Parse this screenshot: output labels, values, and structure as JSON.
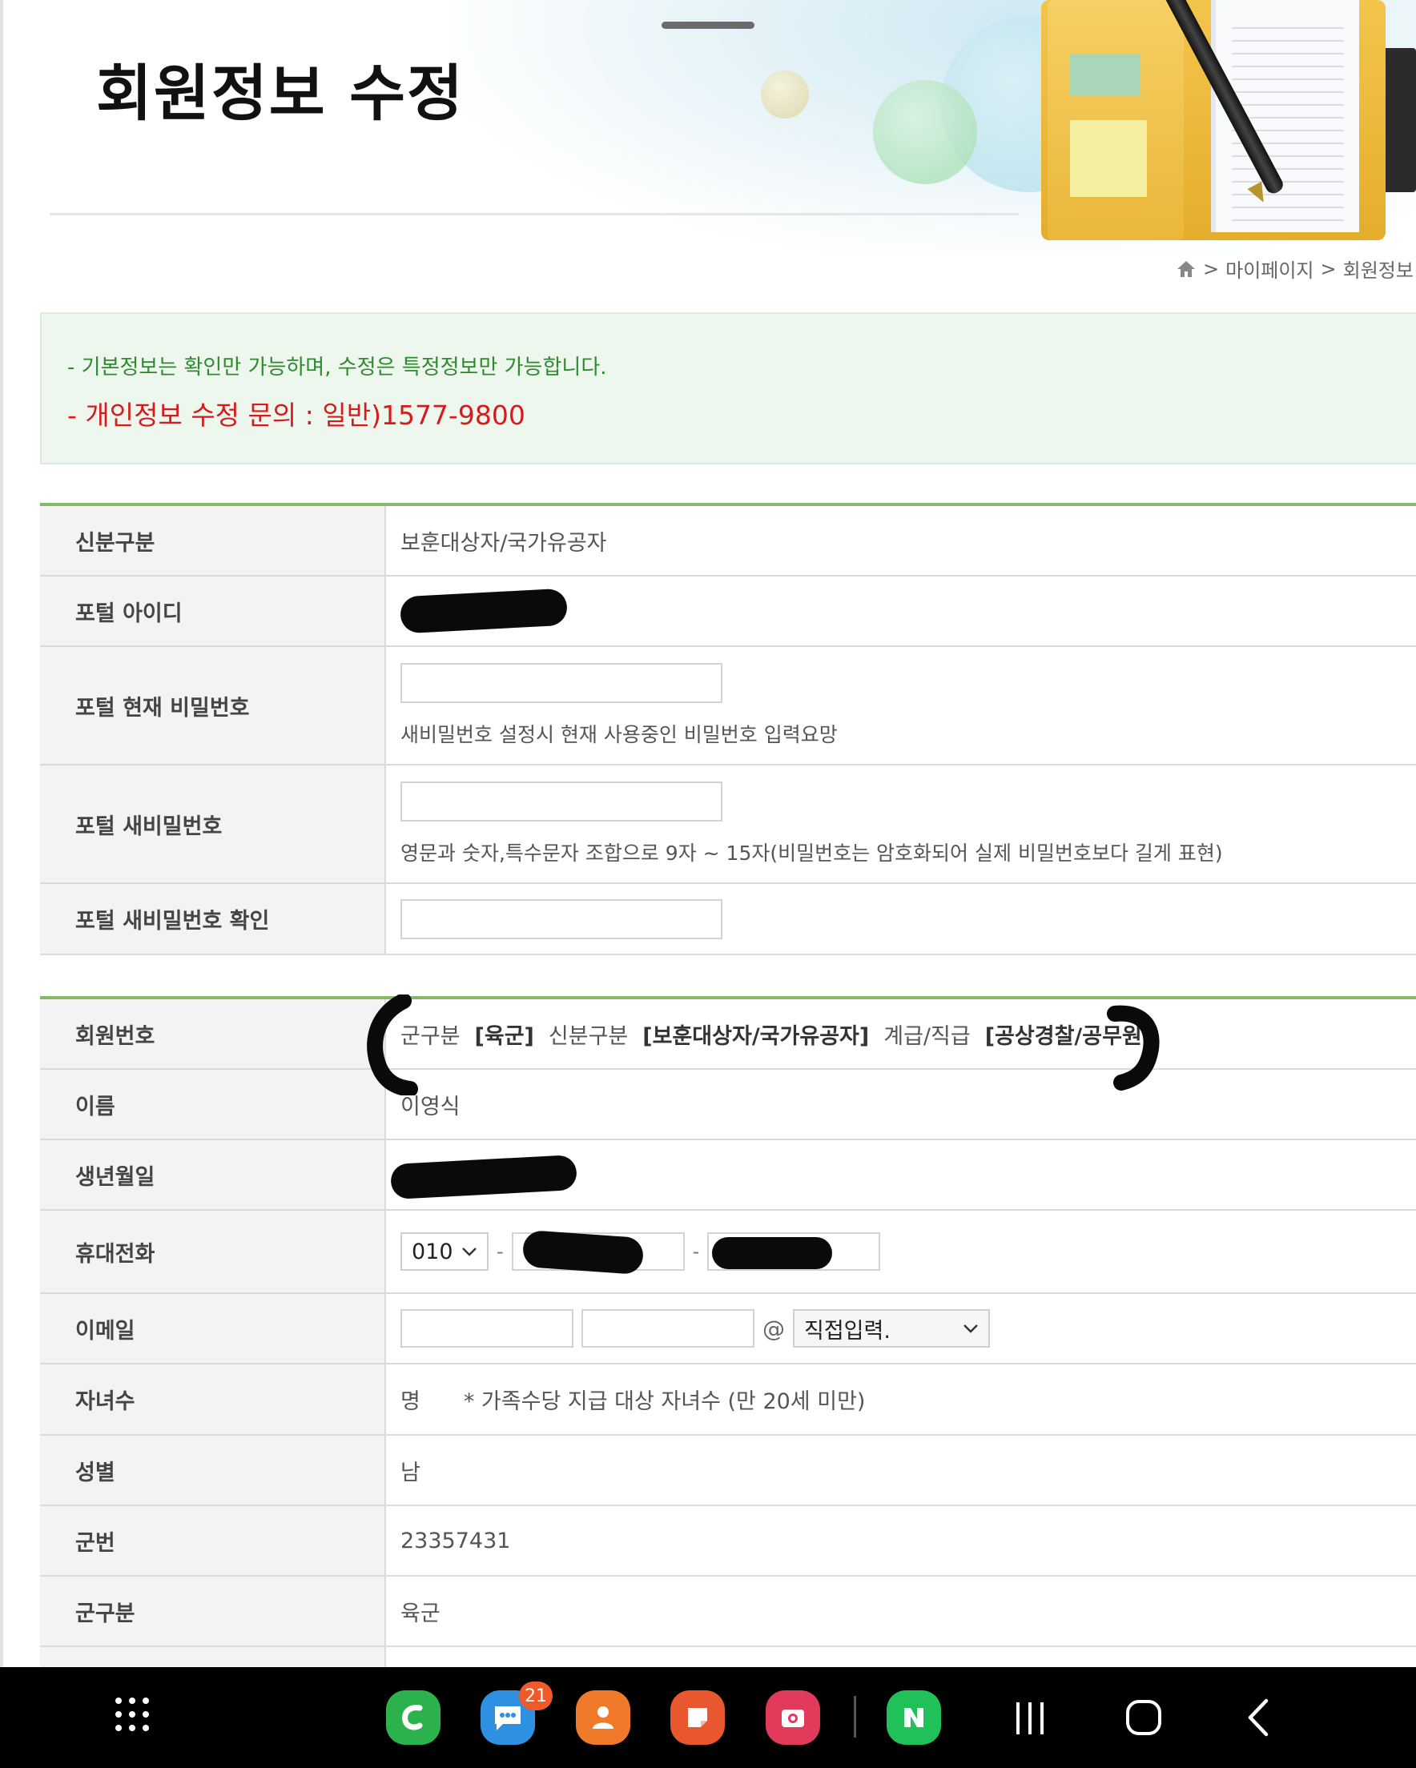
{
  "header": {
    "title": "회원정보 수정",
    "breadcrumb": [
      ">",
      "마이페이지",
      ">",
      "회원정보"
    ]
  },
  "notice": {
    "line1": "- 기본정보는 확인만 가능하며, 수정은 특정정보만 가능합니다.",
    "line2": "- 개인정보 수정 문의 : 일반)1577-9800"
  },
  "account": {
    "status_label": "신분구분",
    "status_value": "보훈대상자/국가유공자",
    "portal_id_label": "포털 아이디",
    "current_pw_label": "포털 현재 비밀번호",
    "current_pw_hint": "새비밀번호 설정시 현재 사용중인 비밀번호 입력요망",
    "new_pw_label": "포털 새비밀번호",
    "new_pw_hint": "영문과 숫자,특수문자 조합으로 9자 ~ 15자(비밀번호는 암호화되어 실제 비밀번호보다 길게 표현)",
    "confirm_pw_label": "포털 새비밀번호 확인"
  },
  "member": {
    "member_no_label": "회원번호",
    "member_no": {
      "branch_label": "군구분",
      "branch_value": "[육군]",
      "status_label": "신분구분",
      "status_value": "[보훈대상자/국가유공자]",
      "rank_label": "계급/직급",
      "rank_value": "[공상경찰/공무원]"
    },
    "name_label": "이름",
    "name_value": "이영식",
    "birth_label": "생년월일",
    "phone_label": "휴대전화",
    "phone_prefix": "010",
    "phone_sep": "-",
    "email_label": "이메일",
    "email_at": "@",
    "email_domain": "직접입력.",
    "children_label": "자녀수",
    "children_unit": "명",
    "children_note": "* 가족수당 지급 대상 자녀수 (만 20세 미만)",
    "gender_label": "성별",
    "gender_value": "남",
    "service_no_label": "군번",
    "service_no_value": "23357431",
    "branch_label": "군구분",
    "branch_value": "육군"
  },
  "navbar": {
    "app_drawer_icon": "grid-icon",
    "apps": [
      "phone-call-icon",
      "messages-icon",
      "contacts-icon",
      "notes-icon",
      "screen-recorder-icon",
      "naver-icon"
    ],
    "messages_badge": "21",
    "recents_icon": "recents-icon",
    "home_icon": "home-button-icon",
    "back_icon": "back-icon"
  },
  "colors": {
    "accent_green": "#86b86a",
    "notice_green": "#2f8a2f",
    "notice_red": "#d41c1c",
    "notice_bg": "#eef7ee"
  }
}
